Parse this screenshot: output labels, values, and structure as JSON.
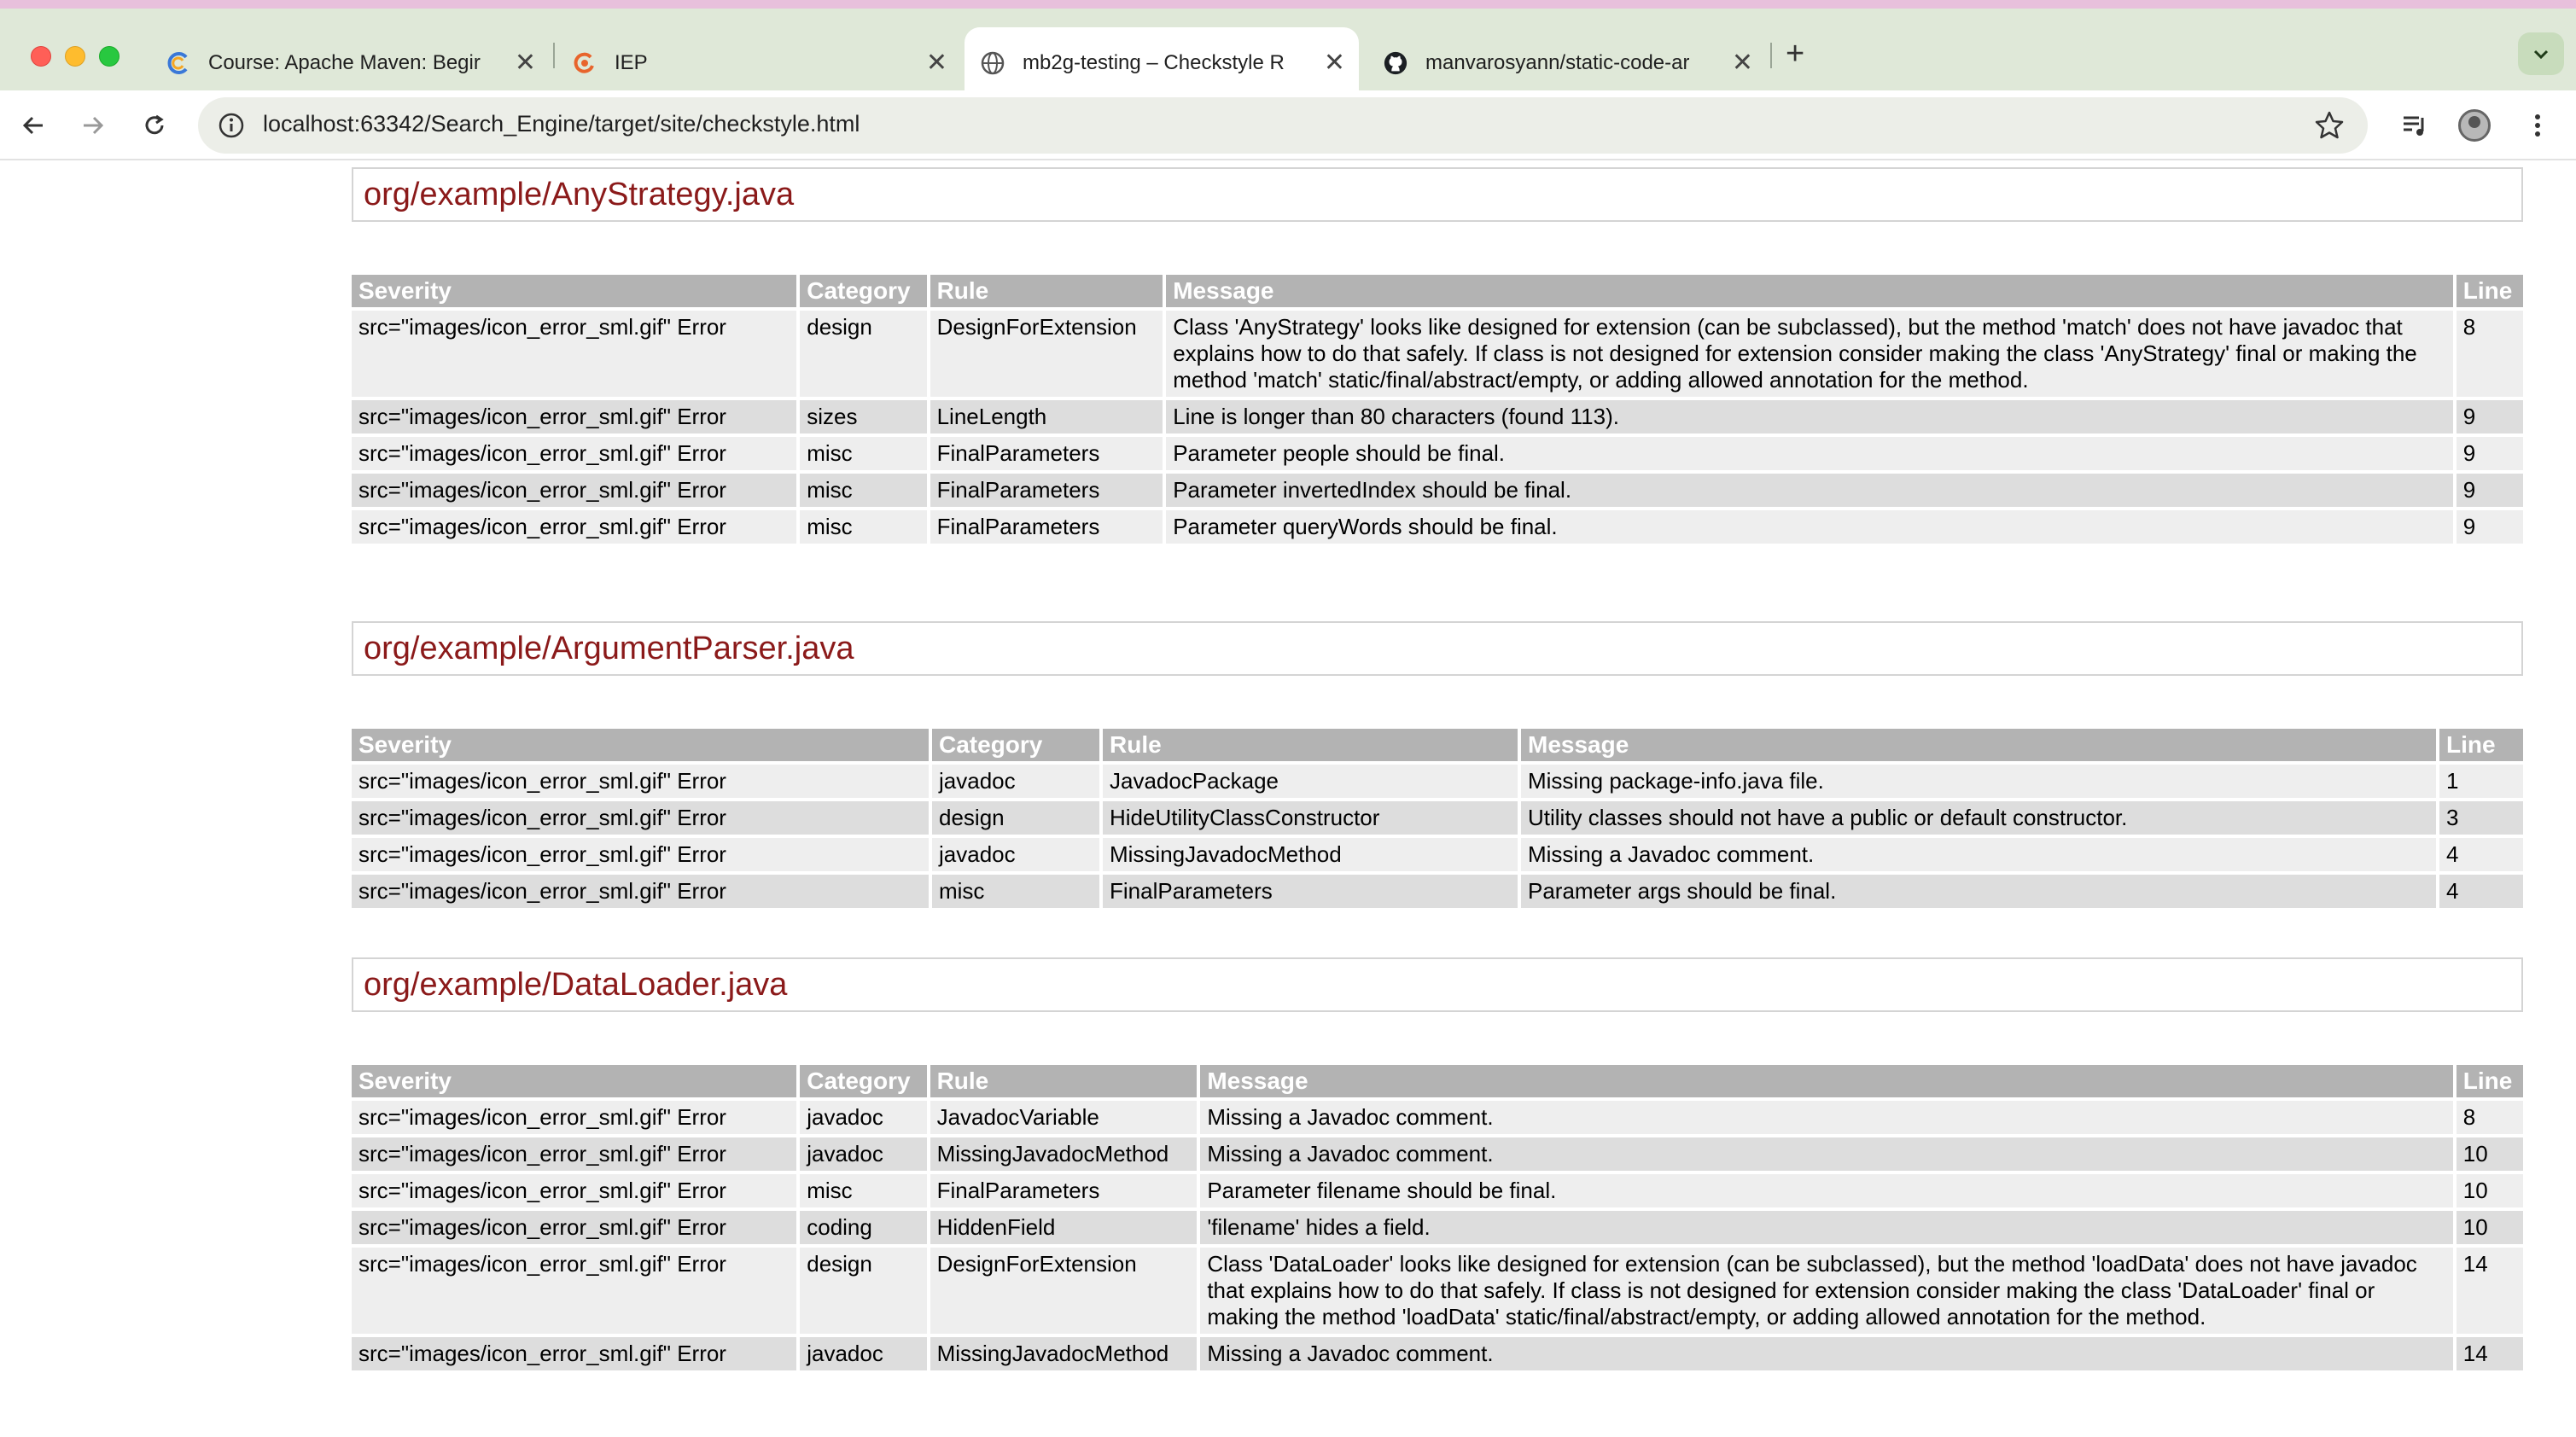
{
  "browser": {
    "tabs": [
      {
        "title": "Course: Apache Maven: Begir",
        "icon": "course-favicon",
        "active": false
      },
      {
        "title": "IEP",
        "icon": "iep-favicon",
        "active": false
      },
      {
        "title": "mb2g-testing – Checkstyle R",
        "icon": "globe-icon",
        "active": true
      },
      {
        "title": "manvarosyann/static-code-ar",
        "icon": "github-icon",
        "active": false
      }
    ],
    "close_glyph": "✕",
    "new_tab_glyph": "+",
    "url": "localhost:63342/Search_Engine/target/site/checkstyle.html"
  },
  "report": {
    "columns": [
      "Severity",
      "Category",
      "Rule",
      "Message",
      "Line"
    ],
    "files": [
      {
        "name": "org/example/AnyStrategy.java",
        "rows": [
          {
            "severity": "src=\"images/icon_error_sml.gif\" Error",
            "category": "design",
            "rule": "DesignForExtension",
            "message": "Class 'AnyStrategy' looks like designed for extension (can be subclassed), but the method 'match' does not have javadoc that explains how to do that safely. If class is not designed for extension consider making the class 'AnyStrategy' final or making the method 'match' static/final/abstract/empty, or adding allowed annotation for the method.",
            "line": "8"
          },
          {
            "severity": "src=\"images/icon_error_sml.gif\" Error",
            "category": "sizes",
            "rule": "LineLength",
            "message": "Line is longer than 80 characters (found 113).",
            "line": "9"
          },
          {
            "severity": "src=\"images/icon_error_sml.gif\" Error",
            "category": "misc",
            "rule": "FinalParameters",
            "message": "Parameter people should be final.",
            "line": "9"
          },
          {
            "severity": "src=\"images/icon_error_sml.gif\" Error",
            "category": "misc",
            "rule": "FinalParameters",
            "message": "Parameter invertedIndex should be final.",
            "line": "9"
          },
          {
            "severity": "src=\"images/icon_error_sml.gif\" Error",
            "category": "misc",
            "rule": "FinalParameters",
            "message": "Parameter queryWords should be final.",
            "line": "9"
          }
        ]
      },
      {
        "name": "org/example/ArgumentParser.java",
        "rows": [
          {
            "severity": "src=\"images/icon_error_sml.gif\" Error",
            "category": "javadoc",
            "rule": "JavadocPackage",
            "message": "Missing package-info.java file.",
            "line": "1"
          },
          {
            "severity": "src=\"images/icon_error_sml.gif\" Error",
            "category": "design",
            "rule": "HideUtilityClassConstructor",
            "message": "Utility classes should not have a public or default constructor.",
            "line": "3"
          },
          {
            "severity": "src=\"images/icon_error_sml.gif\" Error",
            "category": "javadoc",
            "rule": "MissingJavadocMethod",
            "message": "Missing a Javadoc comment.",
            "line": "4"
          },
          {
            "severity": "src=\"images/icon_error_sml.gif\" Error",
            "category": "misc",
            "rule": "FinalParameters",
            "message": "Parameter args should be final.",
            "line": "4"
          }
        ]
      },
      {
        "name": "org/example/DataLoader.java",
        "rows": [
          {
            "severity": "src=\"images/icon_error_sml.gif\" Error",
            "category": "javadoc",
            "rule": "JavadocVariable",
            "message": "Missing a Javadoc comment.",
            "line": "8"
          },
          {
            "severity": "src=\"images/icon_error_sml.gif\" Error",
            "category": "javadoc",
            "rule": "MissingJavadocMethod",
            "message": "Missing a Javadoc comment.",
            "line": "10"
          },
          {
            "severity": "src=\"images/icon_error_sml.gif\" Error",
            "category": "misc",
            "rule": "FinalParameters",
            "message": "Parameter filename should be final.",
            "line": "10"
          },
          {
            "severity": "src=\"images/icon_error_sml.gif\" Error",
            "category": "coding",
            "rule": "HiddenField",
            "message": "'filename' hides a field.",
            "line": "10"
          },
          {
            "severity": "src=\"images/icon_error_sml.gif\" Error",
            "category": "design",
            "rule": "DesignForExtension",
            "message": "Class 'DataLoader' looks like designed for extension (can be subclassed), but the method 'loadData' does not have javadoc that explains how to do that safely. If class is not designed for extension consider making the class 'DataLoader' final or making the method 'loadData' static/final/abstract/empty, or adding allowed annotation for the method.",
            "line": "14"
          },
          {
            "severity": "src=\"images/icon_error_sml.gif\" Error",
            "category": "javadoc",
            "rule": "MissingJavadocMethod",
            "message": "Missing a Javadoc comment.",
            "line": "14"
          }
        ]
      }
    ]
  },
  "colors": {
    "file_title": "#8b1a1a",
    "header_bg": "#b3b3b3",
    "row_odd": "#eeeeee",
    "row_even": "#dddddd",
    "chrome_bg": "#dfe8d8"
  }
}
